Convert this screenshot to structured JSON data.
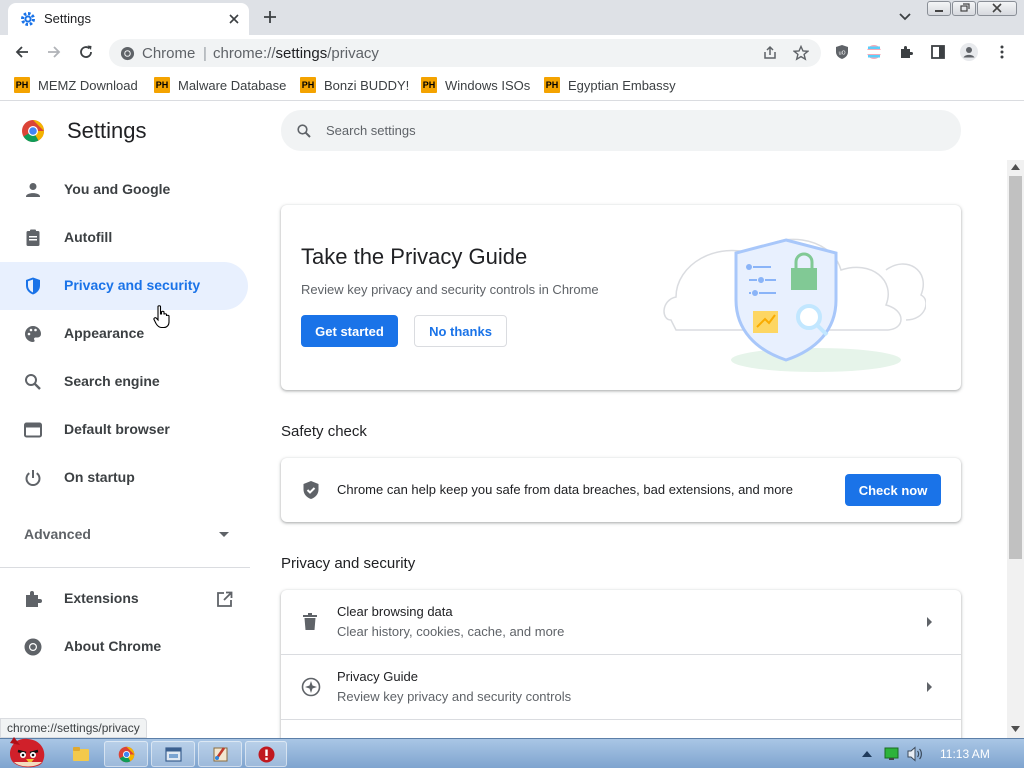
{
  "tab": {
    "title": "Settings"
  },
  "toolbar": {
    "site_label": "Chrome",
    "url_prefix": "chrome://",
    "url_path": "settings",
    "url_suffix": "/privacy"
  },
  "bookmarks": [
    {
      "badge": "PH",
      "label": "MEMZ Download"
    },
    {
      "badge": "PH",
      "label": "Malware Database"
    },
    {
      "badge": "PH",
      "label": "Bonzi BUDDY!"
    },
    {
      "badge": "PH",
      "label": "Windows ISOs"
    },
    {
      "badge": "PH",
      "label": "Egyptian Embassy"
    }
  ],
  "sidebar": {
    "title": "Settings",
    "items": [
      {
        "label": "You and Google",
        "icon": "person-icon"
      },
      {
        "label": "Autofill",
        "icon": "clipboard-icon"
      },
      {
        "label": "Privacy and security",
        "icon": "shield-icon",
        "active": true
      },
      {
        "label": "Appearance",
        "icon": "palette-icon"
      },
      {
        "label": "Search engine",
        "icon": "search-icon"
      },
      {
        "label": "Default browser",
        "icon": "browser-icon"
      },
      {
        "label": "On startup",
        "icon": "power-icon"
      }
    ],
    "advanced": "Advanced",
    "extensions": "Extensions",
    "about": "About Chrome"
  },
  "search": {
    "placeholder": "Search settings"
  },
  "privacy_guide": {
    "title": "Take the Privacy Guide",
    "description": "Review key privacy and security controls in Chrome",
    "primary_button": "Get started",
    "secondary_button": "No thanks"
  },
  "safety_check": {
    "heading": "Safety check",
    "text": "Chrome can help keep you safe from data breaches, bad extensions, and more",
    "button": "Check now"
  },
  "privacy_section": {
    "heading": "Privacy and security",
    "rows": [
      {
        "title": "Clear browsing data",
        "subtitle": "Clear history, cookies, cache, and more"
      },
      {
        "title": "Privacy Guide",
        "subtitle": "Review key privacy and security controls"
      }
    ]
  },
  "status_bar": "chrome://settings/privacy",
  "taskbar": {
    "clock": "11:13 AM"
  },
  "colors": {
    "accent": "#1a73e8",
    "active_nav_bg": "#e8f0fe",
    "tabstrip": "#dee1e6"
  }
}
